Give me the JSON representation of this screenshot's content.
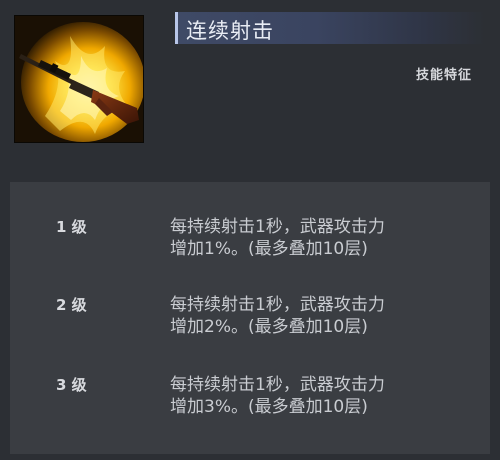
{
  "skill": {
    "icon": "sniper-rifle-icon",
    "name": "连续射击",
    "category": "技能特征"
  },
  "levels": [
    {
      "label": "1 级",
      "line1": "每持续射击1秒，武器攻击力",
      "line2": "增加1%。(最多叠加10层)"
    },
    {
      "label": "2 级",
      "line1": "每持续射击1秒，武器攻击力",
      "line2": "增加2%。(最多叠加10层)"
    },
    {
      "label": "3 级",
      "line1": "每持续射击1秒，武器攻击力",
      "line2": "增加3%。(最多叠加10层)"
    }
  ]
}
